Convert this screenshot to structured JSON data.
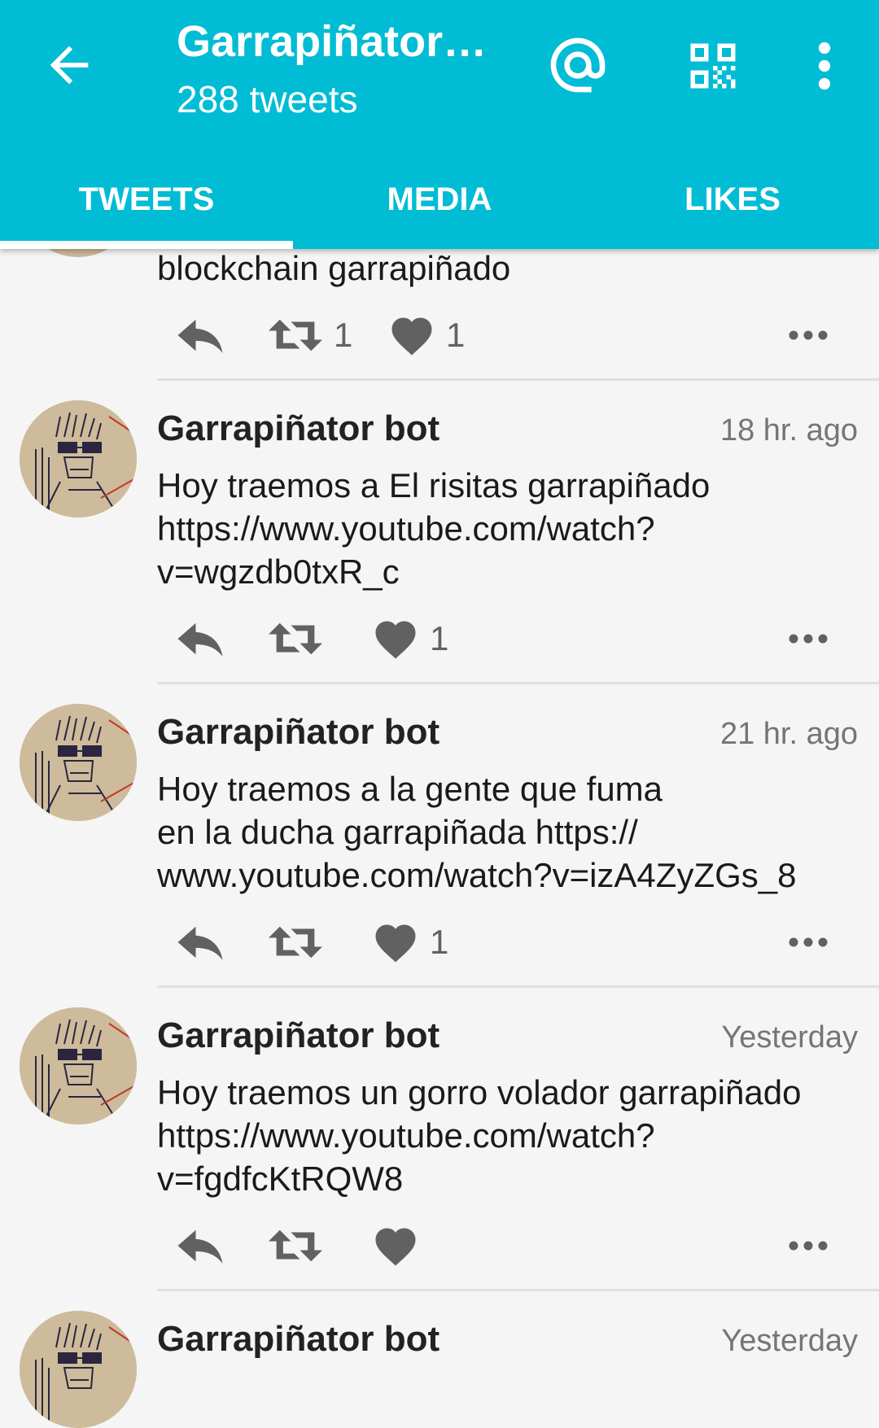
{
  "header": {
    "title": "Garrapiñator…",
    "subtitle": "288 tweets"
  },
  "tabs": [
    {
      "label": "TWEETS",
      "active": true
    },
    {
      "label": "MEDIA",
      "active": false
    },
    {
      "label": "LIKES",
      "active": false
    }
  ],
  "tweets": [
    {
      "author": "",
      "time": "",
      "lines": [
        "blockchain garrapiñado"
      ],
      "retweets": "1",
      "likes": "1"
    },
    {
      "author": "Garrapiñator bot",
      "time": "18 hr. ago",
      "lines": [
        "Hoy traemos a El risitas garrapiñado",
        "https://www.youtube.com/watch?",
        "v=wgzdb0txR_c"
      ],
      "retweets": "",
      "likes": "1"
    },
    {
      "author": "Garrapiñator bot",
      "time": "21 hr. ago",
      "lines": [
        "Hoy traemos a la gente que fuma",
        "en la ducha garrapiñada https://",
        "www.youtube.com/watch?v=izA4ZyZGs_8"
      ],
      "retweets": "",
      "likes": "1"
    },
    {
      "author": "Garrapiñator bot",
      "time": "Yesterday",
      "lines": [
        "Hoy traemos un gorro volador garrapiñado",
        "https://www.youtube.com/watch?",
        "v=fgdfcKtRQW8"
      ],
      "retweets": "",
      "likes": ""
    },
    {
      "author": "Garrapiñator bot",
      "time": "Yesterday",
      "lines": [],
      "retweets": "",
      "likes": ""
    }
  ],
  "colors": {
    "appbar": "#00bcd4",
    "background": "#f5f5f5",
    "icon_gray": "#616161"
  },
  "icons": [
    "back-arrow-icon",
    "at-sign-icon",
    "qr-code-icon",
    "more-vert-icon",
    "reply-icon",
    "retweet-icon",
    "heart-icon",
    "more-horiz-icon"
  ]
}
